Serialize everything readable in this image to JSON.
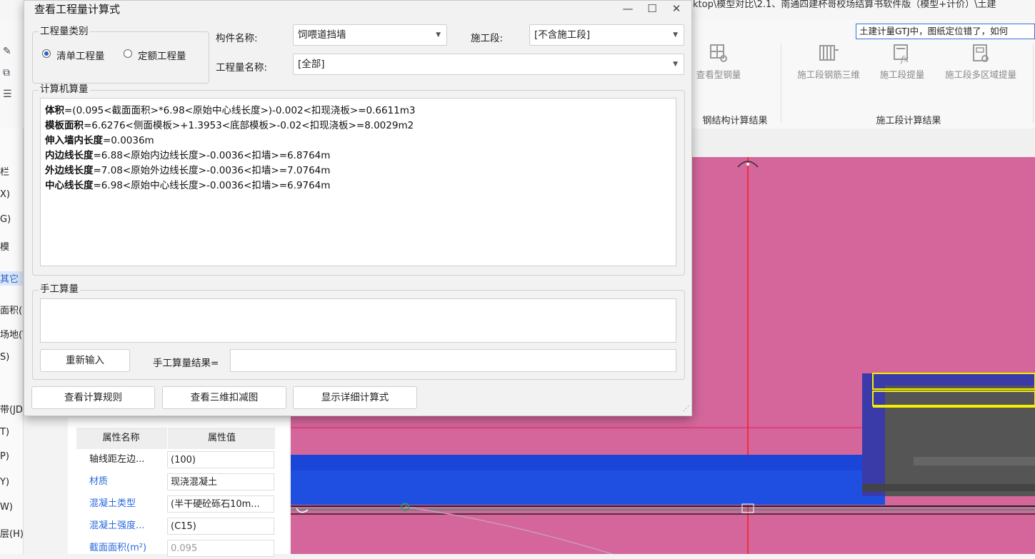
{
  "background_app": {
    "title_fragment": "ktop\\模型对比\\2.1、南通四建杯哥校场结算书软件版（模型+计价）\\土建",
    "search_text": "土建计量GTJ中，图纸定位错了，如何",
    "ribbon_buttons": [
      {
        "label": "查看型钢量",
        "icon": "grid-search-icon"
      },
      {
        "label": "施工段钢筋三维",
        "icon": "rebar-3d-icon"
      },
      {
        "label": "施工段提量",
        "icon": "formula-fx-icon"
      },
      {
        "label": "施工段多区域提量",
        "icon": "multi-area-icon"
      }
    ],
    "ribbon_groups": [
      "钢结构计算结果",
      "施工段计算结果"
    ],
    "left_items": [
      "栏",
      "X)",
      "G)",
      "模",
      "其它",
      "面积(l",
      "场地(\\",
      "S)",
      "带(JD",
      "T)",
      "P)",
      "Y)",
      "W)",
      "层(H)"
    ],
    "left_selected_index": 4,
    "properties": {
      "header_name": "属性名称",
      "header_value": "属性值",
      "rows": [
        {
          "name": "轴线距左边...",
          "value": "(100)",
          "name_blue": false,
          "value_dim": false
        },
        {
          "name": "材质",
          "value": "现浇混凝土",
          "name_blue": true,
          "value_dim": false
        },
        {
          "name": "混凝土类型",
          "value": "(半干硬砼砾石10m...",
          "name_blue": true,
          "value_dim": false
        },
        {
          "name": "混凝土强度...",
          "value": "(C15)",
          "name_blue": true,
          "value_dim": false
        },
        {
          "name": "截面面积(m²)",
          "value": "0.095",
          "name_blue": true,
          "value_dim": true
        }
      ]
    },
    "colors": {
      "viewport": "#d4669c",
      "beam_blue": "#1f4fe0",
      "dark_gray": "#555555",
      "accent_yellow": "#f5f000",
      "axis_red": "#ff1a1a"
    }
  },
  "dialog": {
    "title": "查看工程量计算式",
    "window_buttons": {
      "minimize": "—",
      "maximize": "☐",
      "close": "✕"
    },
    "category": {
      "legend": "工程量类别",
      "options": [
        "清单工程量",
        "定额工程量"
      ],
      "selected": 0
    },
    "component_label": "构件名称:",
    "component_value": "饲喂道挡墙",
    "stage_label": "施工段:",
    "stage_value": "[不含施工段]",
    "quantity_label": "工程量名称:",
    "quantity_value": "[全部]",
    "computer_section": {
      "legend": "计算机算量",
      "lines": [
        {
          "bold": "体积",
          "rest": "=(0.095<截面面积>*6.98<原始中心线长度>)-0.002<扣现浇板>=0.6611m3"
        },
        {
          "bold": "模板面积",
          "rest": "=6.6276<侧面模板>+1.3953<底部模板>-0.02<扣现浇板>=8.0029m2"
        },
        {
          "bold": "伸入墙内长度",
          "rest": "=0.0036m"
        },
        {
          "bold": "内边线长度",
          "rest": "=6.88<原始内边线长度>-0.0036<扣墙>=6.8764m"
        },
        {
          "bold": "外边线长度",
          "rest": "=7.08<原始外边线长度>-0.0036<扣墙>=7.0764m"
        },
        {
          "bold": "中心线长度",
          "rest": "=6.98<原始中心线长度>-0.0036<扣墙>=6.9764m"
        }
      ]
    },
    "manual_section": {
      "legend": "手工算量",
      "reinput_label": "重新输入",
      "result_label": "手工算量结果=",
      "result_value": ""
    },
    "bottom_buttons": [
      "查看计算规则",
      "查看三维扣减图",
      "显示详细计算式"
    ]
  }
}
